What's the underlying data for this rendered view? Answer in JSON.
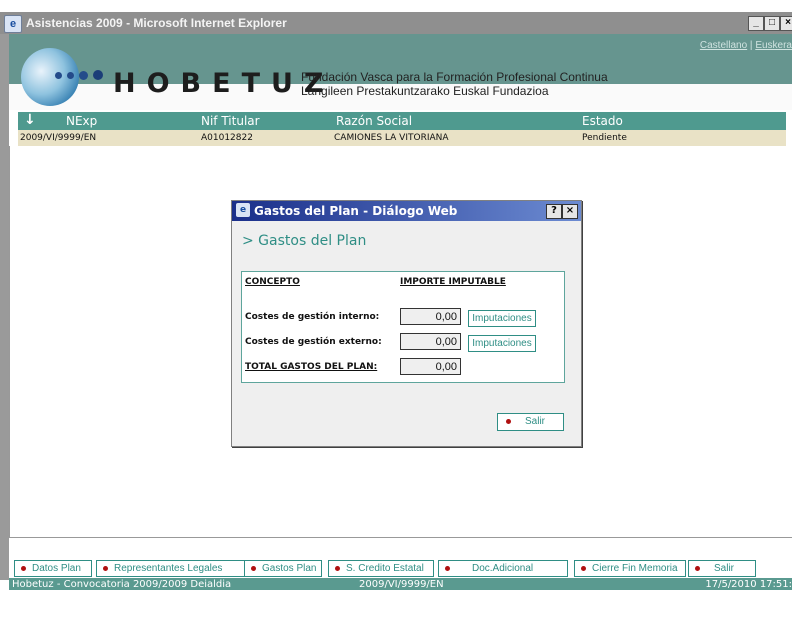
{
  "window": {
    "title": "Asistencias 2009 - Microsoft Internet Explorer"
  },
  "header": {
    "lang_castellano": "Castellano",
    "lang_sep": " | ",
    "lang_euskera": "Euskera",
    "brand": "HOBETUZ",
    "subtitle_es": "Fundación Vasca para la Formación Profesional Continua",
    "subtitle_eu": "Langileen Prestakuntzarako Euskal Fundazioa"
  },
  "table": {
    "sort_icon": "↓",
    "columns": [
      "NExp",
      "Nif Titular",
      "Razón Social",
      "Estado"
    ],
    "rows": [
      [
        "2009/VI/9999/EN",
        "A01012822",
        "CAMIONES LA VITORIANA",
        "Pendiente"
      ]
    ]
  },
  "dialog": {
    "title": "Gastos del Plan - Diálogo Web",
    "help": "?",
    "close": "×",
    "heading": "> Gastos del Plan",
    "col_concepto": "CONCEPTO",
    "col_importe": "IMPORTE IMPUTABLE",
    "rows": [
      {
        "label": "Costes de gestión interno:",
        "value": "0,00",
        "button": "Imputaciones"
      },
      {
        "label": "Costes de gestión externo:",
        "value": "0,00",
        "button": "Imputaciones"
      }
    ],
    "total_label": "TOTAL GASTOS DEL PLAN:",
    "total_value": "0,00",
    "salir": "Salir"
  },
  "tabs": [
    "Datos Plan",
    "Representantes Legales",
    "Gastos Plan",
    "S. Credito Estatal",
    "Doc.Adicional",
    "Cierre Fin Memoria",
    "Salir"
  ],
  "status": {
    "left": "Hobetuz - Convocatoria 2009/2009 Deialdia",
    "center": "2009/VI/9999/EN",
    "right": "17/5/2010 17:51:"
  },
  "colors": {
    "teal": "#4f9a8f",
    "accent_text": "#2f8e85",
    "row_bg": "#e9e2c6"
  }
}
